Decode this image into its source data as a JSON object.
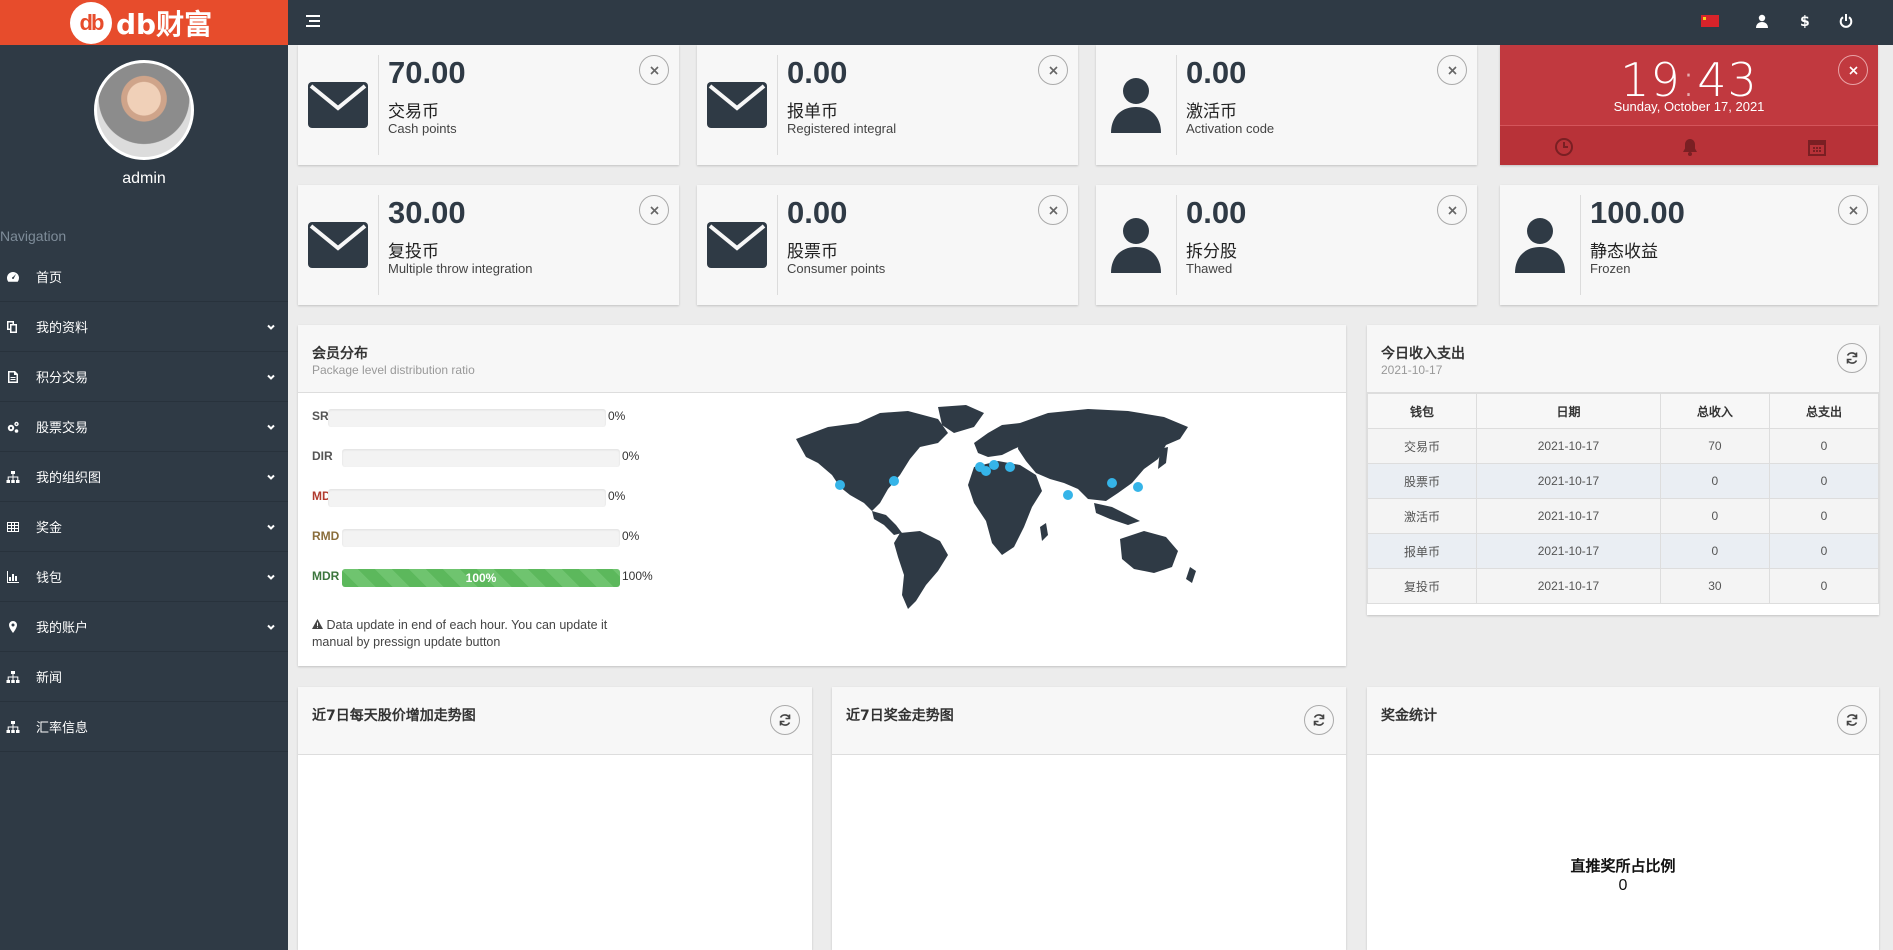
{
  "brand": {
    "logo_mark": "db",
    "logo_text": "db财富"
  },
  "user": {
    "name": "admin"
  },
  "nav": {
    "header": "Navigation",
    "items": [
      {
        "label": "首页",
        "icon": "dashboard-icon",
        "expandable": false
      },
      {
        "label": "我的资料",
        "icon": "copy-icon",
        "expandable": true
      },
      {
        "label": "积分交易",
        "icon": "file-icon",
        "expandable": true
      },
      {
        "label": "股票交易",
        "icon": "gears-icon",
        "expandable": true
      },
      {
        "label": "我的组织图",
        "icon": "sitemap-icon",
        "expandable": true
      },
      {
        "label": "奖金",
        "icon": "table-icon",
        "expandable": true
      },
      {
        "label": "钱包",
        "icon": "bar-chart-icon",
        "expandable": true
      },
      {
        "label": "我的账户",
        "icon": "map-marker-icon",
        "expandable": true
      },
      {
        "label": "新闻",
        "icon": "sitemap-icon",
        "expandable": false
      },
      {
        "label": "汇率信息",
        "icon": "sitemap-icon",
        "expandable": false
      }
    ]
  },
  "topbar": {
    "icons": [
      "menu-icon",
      "flag-icon",
      "user-icon",
      "dollar-icon",
      "power-icon"
    ]
  },
  "stats": [
    {
      "value": "70.00",
      "label": "交易币",
      "sub": "Cash points",
      "icon": "envelope-icon"
    },
    {
      "value": "0.00",
      "label": "报单币",
      "sub": "Registered integral",
      "icon": "envelope-icon"
    },
    {
      "value": "0.00",
      "label": "激活币",
      "sub": "Activation code",
      "icon": "user-icon"
    },
    {
      "value": "30.00",
      "label": "复投币",
      "sub": "Multiple throw integration",
      "icon": "envelope-icon"
    },
    {
      "value": "0.00",
      "label": "股票币",
      "sub": "Consumer points",
      "icon": "envelope-icon"
    },
    {
      "value": "0.00",
      "label": "拆分股",
      "sub": "Thawed",
      "icon": "user-icon"
    },
    {
      "value": "100.00",
      "label": "静态收益",
      "sub": "Frozen",
      "icon": "user-icon"
    }
  ],
  "clock": {
    "hours": "19",
    "minutes": "43",
    "date": "Sunday, October 17, 2021",
    "accent": "#c1393f"
  },
  "distribution": {
    "title": "会员分布",
    "subtitle": "Package level distribution ratio",
    "levels": [
      {
        "name": "SR",
        "percent": 0,
        "percent_label": "0%",
        "color": "#555555"
      },
      {
        "name": "DIR",
        "percent": 0,
        "percent_label": "0%",
        "color": "#555555"
      },
      {
        "name": "MD",
        "percent": 0,
        "percent_label": "0%",
        "color": "#b03a2e"
      },
      {
        "name": "RMD",
        "percent": 0,
        "percent_label": "0%",
        "color": "#8a6d3b"
      },
      {
        "name": "MDR",
        "percent": 100,
        "percent_label": "100%",
        "bar_label": "100%",
        "color": "#3c763d"
      }
    ],
    "note": "Data update in end of each hour. You can update it manual by pressign update button"
  },
  "income": {
    "title": "今日收入支出",
    "date": "2021-10-17",
    "columns": [
      "钱包",
      "日期",
      "总收入",
      "总支出"
    ],
    "rows": [
      [
        "交易币",
        "2021-10-17",
        "70",
        "0"
      ],
      [
        "股票币",
        "2021-10-17",
        "0",
        "0"
      ],
      [
        "激活币",
        "2021-10-17",
        "0",
        "0"
      ],
      [
        "报单币",
        "2021-10-17",
        "0",
        "0"
      ],
      [
        "复投币",
        "2021-10-17",
        "30",
        "0"
      ]
    ]
  },
  "panels": {
    "stock_trend": {
      "title": "近7日每天股价增加走势图"
    },
    "bonus_trend": {
      "title": "近7日奖金走势图"
    },
    "bonus_stats": {
      "title": "奖金统计",
      "pie_title": "直推奖所占比例",
      "pie_value": "0"
    }
  },
  "colors": {
    "sidebar": "#2f3a45",
    "brand": "#e74c2c",
    "progress": "#5cb85c",
    "map_dot": "#35b4e8"
  }
}
